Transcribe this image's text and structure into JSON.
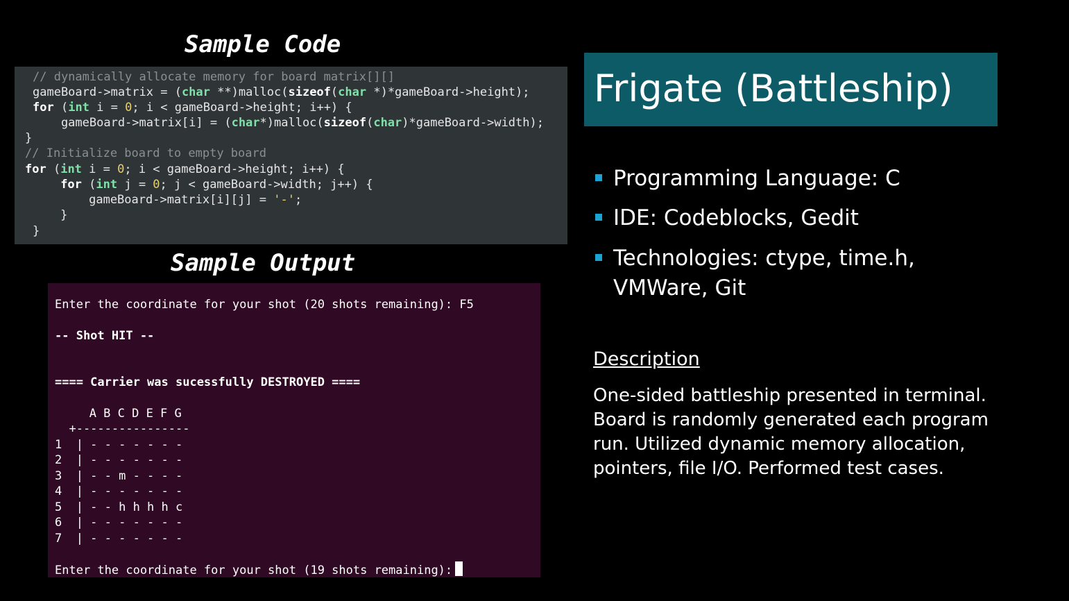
{
  "sample_code": {
    "heading": "Sample Code",
    "comment1": "// dynamically allocate memory for board matrix[][]",
    "comment2": "// Initialize board to empty board",
    "kw_for": "for",
    "kw_sizeof": "sizeof",
    "ty_char": "char",
    "ty_int": "int",
    "num_zero": "0",
    "str_dash": "'-'"
  },
  "sample_output": {
    "heading": "Sample Output",
    "prompt1": "Enter the coordinate for your shot (20 shots remaining): F5",
    "shot_hit": "-- Shot HIT --",
    "destroyed": "==== Carrier was sucessfully DESTROYED ====",
    "col_header": "   A B C D E F G",
    "separator": "  +----------------",
    "rows": [
      "1  | - - - - - - -",
      "2  | - - - - - - -",
      "3  | - - m - - - -",
      "4  | - - - - - - -",
      "5  | - - h h h h c",
      "6  | - - - - - - -",
      "7  | - - - - - - -"
    ],
    "prompt2": "Enter the coordinate for your shot (19 shots remaining):"
  },
  "title": "Frigate (Battleship)",
  "bullets": [
    {
      "text": "Programming Language: C"
    },
    {
      "text": "IDE: Codeblocks, Gedit"
    },
    {
      "text": "Technologies: ctype, time.h,\nVMWare, Git"
    }
  ],
  "description": {
    "heading": "Description",
    "lines": [
      "One-sided battleship presented in terminal.",
      "Board is randomly generated each program",
      "run. Utilized dynamic memory allocation,",
      "pointers, file I/O. Performed test cases."
    ]
  },
  "colors": {
    "background": "#000000",
    "code_bg": "#2f3436",
    "terminal_bg": "#300a24",
    "title_bg": "#0e5b68",
    "bullet": "#1ba3d4"
  }
}
